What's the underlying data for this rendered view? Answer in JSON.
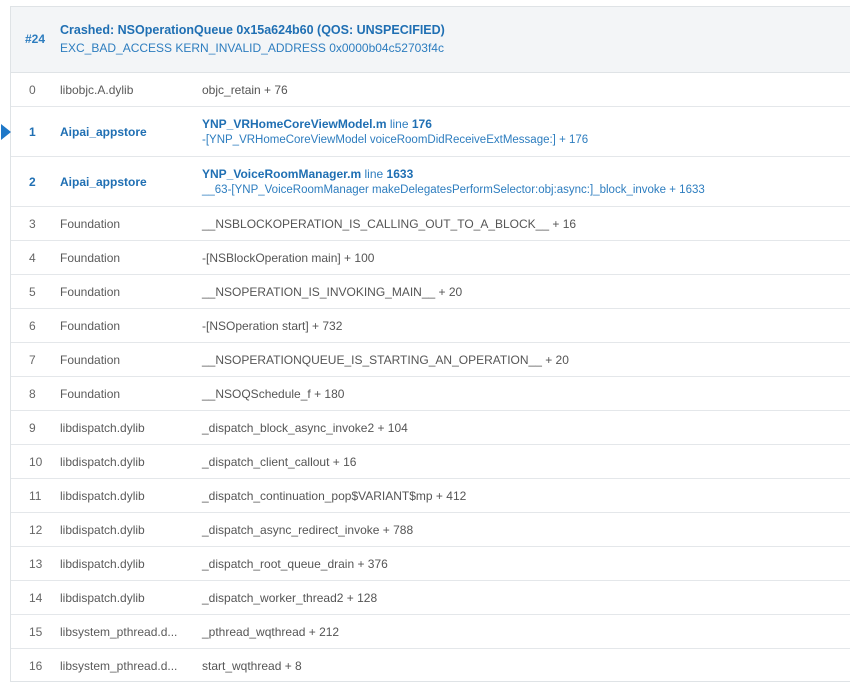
{
  "header": {
    "thread_number": "#24",
    "title": "Crashed: NSOperationQueue 0x15a624b60 (QOS: UNSPECIFIED)",
    "subtitle": "EXC_BAD_ACCESS KERN_INVALID_ADDRESS 0x0000b04c52703f4c"
  },
  "frames": [
    {
      "index": "0",
      "library": "libobjc.A.dylib",
      "symbol": "objc_retain + 76"
    },
    {
      "index": "1",
      "library": "Aipai_appstore",
      "file": "YNP_VRHomeCoreViewModel.m",
      "line_word": "line",
      "line_number": "176",
      "symbol": "-[YNP_VRHomeCoreViewModel voiceRoomDidReceiveExtMessage:] + 176"
    },
    {
      "index": "2",
      "library": "Aipai_appstore",
      "file": "YNP_VoiceRoomManager.m",
      "line_word": "line",
      "line_number": "1633",
      "symbol": "__63-[YNP_VoiceRoomManager makeDelegatesPerformSelector:obj:async:]_block_invoke + 1633"
    },
    {
      "index": "3",
      "library": "Foundation",
      "symbol": "__NSBLOCKOPERATION_IS_CALLING_OUT_TO_A_BLOCK__ + 16"
    },
    {
      "index": "4",
      "library": "Foundation",
      "symbol": "-[NSBlockOperation main] + 100"
    },
    {
      "index": "5",
      "library": "Foundation",
      "symbol": "__NSOPERATION_IS_INVOKING_MAIN__ + 20"
    },
    {
      "index": "6",
      "library": "Foundation",
      "symbol": "-[NSOperation start] + 732"
    },
    {
      "index": "7",
      "library": "Foundation",
      "symbol": "__NSOPERATIONQUEUE_IS_STARTING_AN_OPERATION__ + 20"
    },
    {
      "index": "8",
      "library": "Foundation",
      "symbol": "__NSOQSchedule_f + 180"
    },
    {
      "index": "9",
      "library": "libdispatch.dylib",
      "symbol": "_dispatch_block_async_invoke2 + 104"
    },
    {
      "index": "10",
      "library": "libdispatch.dylib",
      "symbol": "_dispatch_client_callout + 16"
    },
    {
      "index": "11",
      "library": "libdispatch.dylib",
      "symbol": "_dispatch_continuation_pop$VARIANT$mp + 412"
    },
    {
      "index": "12",
      "library": "libdispatch.dylib",
      "symbol": "_dispatch_async_redirect_invoke + 788"
    },
    {
      "index": "13",
      "library": "libdispatch.dylib",
      "symbol": "_dispatch_root_queue_drain + 376"
    },
    {
      "index": "14",
      "library": "libdispatch.dylib",
      "symbol": "_dispatch_worker_thread2 + 128"
    },
    {
      "index": "15",
      "library": "libsystem_pthread.d...",
      "symbol": "_pthread_wqthread + 212"
    },
    {
      "index": "16",
      "library": "libsystem_pthread.d...",
      "symbol": "start_wqthread + 8"
    }
  ],
  "colors": {
    "accent": "#1f6fb3",
    "header_bg": "#f3f5f7",
    "border": "#e4e7ea"
  }
}
